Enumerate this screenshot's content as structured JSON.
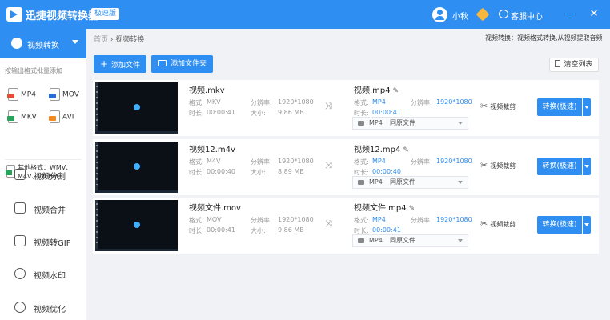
{
  "app": {
    "title": "迅捷视频转换器",
    "badge": "极速版",
    "username": "小秋",
    "service": "客服中心"
  },
  "sidebar": {
    "active": "视频转换",
    "hint": "按输出格式批量添加",
    "formats": [
      "MP4",
      "MOV",
      "MKV",
      "AVI"
    ],
    "other_formats": [
      "其他格式：WMV、",
      "M4V、WEBM..."
    ],
    "items": [
      "视频分割",
      "视频合并",
      "视频转GIF",
      "视频水印",
      "视频优化"
    ]
  },
  "breadcrumb": {
    "home": "首页",
    "sep": "›",
    "current": "视频转换"
  },
  "notice": "视频转换：视频格式转换,从视频提取音频",
  "toolbar": {
    "add_file": "添加文件",
    "add_folder": "添加文件夹",
    "clear": "清空列表"
  },
  "labels": {
    "format": "格式:",
    "resolution": "分辨率:",
    "duration": "时长:",
    "size": "大小:",
    "cut": "视频裁剪",
    "convert": "转换(极速)"
  },
  "files": [
    {
      "name": "视频.mkv",
      "format": "MKV",
      "resolution": "1920*1080",
      "duration": "00:00:41",
      "size": "9.86 MB",
      "out_name": "视频.mp4",
      "out_format": "MP4",
      "out_resolution": "1920*1080",
      "out_duration": "00:00:41",
      "preset": "MP4",
      "quality": "同原文件"
    },
    {
      "name": "视频12.m4v",
      "format": "M4V",
      "resolution": "1920*1080",
      "duration": "00:00:40",
      "size": "8.89 MB",
      "out_name": "视频12.mp4",
      "out_format": "MP4",
      "out_resolution": "1920*1080",
      "out_duration": "00:00:40",
      "preset": "MP4",
      "quality": "同原文件"
    },
    {
      "name": "视频文件.mov",
      "format": "MOV",
      "resolution": "1920*1080",
      "duration": "00:00:41",
      "size": "9.86 MB",
      "out_name": "视频文件.mp4",
      "out_format": "MP4",
      "out_resolution": "1920*1080",
      "out_duration": "00:00:41",
      "preset": "MP4",
      "quality": "同原文件"
    }
  ]
}
